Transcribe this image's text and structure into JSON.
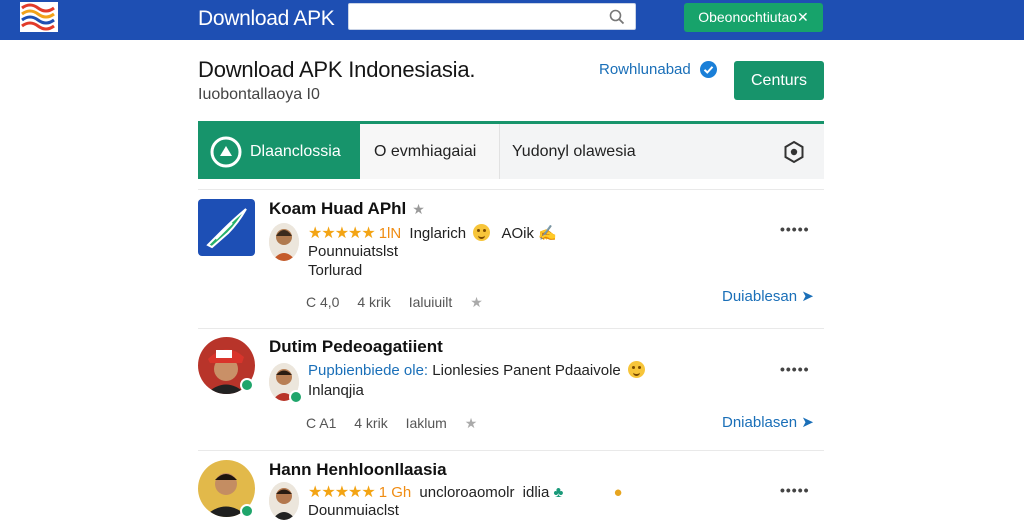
{
  "topbar": {
    "brand": "Download APK",
    "search_placeholder": "",
    "action_button": "Obeonochtiutao✕"
  },
  "header": {
    "title": "Download APK Indonesiasia.",
    "subtitle": "Iuobontallaoya I0",
    "verified_link": "Rowhlunabad",
    "continue_button": "Centurs"
  },
  "tabs": [
    {
      "label": "Dlaanclossia"
    },
    {
      "label": "O evmhiagaiai"
    },
    {
      "label": "Yudonyl olawesia"
    }
  ],
  "items": [
    {
      "title": "Koam Huad APhl",
      "title_mark": "★",
      "rating_count": "1ƖN",
      "rating_tag": "Inglarich",
      "rating_extra": "AOik",
      "line2": "Pounnuiatslst",
      "line3": "Torlurad",
      "meta": [
        "C 4,0",
        "4 krik",
        "Ialuiuilt"
      ],
      "action": "Duiablesan ➤"
    },
    {
      "title": "Dutim Pedeoagatiient",
      "line2_blue": "Pupbienbiede ole:",
      "line2_rest": "Lionlesies Panent Pdaaivole",
      "line3": "Inlanqjia",
      "meta": [
        "C A\u00041",
        "4 krik",
        "Iaklum"
      ],
      "action": "Dniablasen ➤"
    },
    {
      "title": "Hann Henhloonllaasia",
      "rating_count": "1 Gh",
      "rating_tag": "uncloroaomolr",
      "rating_extra": "idlia",
      "line2": "Dounmuiaclst"
    }
  ],
  "colors": {
    "topbar": "#1e4fb3",
    "accent_green": "#17946b",
    "link_blue": "#1a6fb8",
    "star": "#f3a414"
  }
}
